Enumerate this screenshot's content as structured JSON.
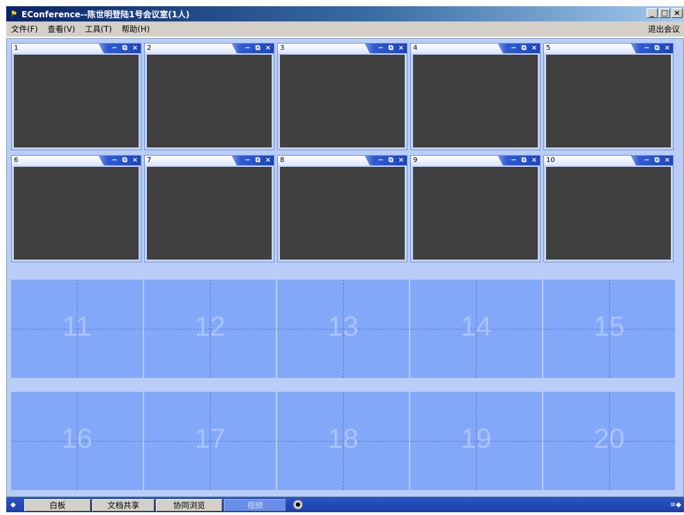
{
  "window": {
    "title": "EConference--陈世明登陆1号会议室(1人)",
    "icon": "app-logo-icon",
    "controls": [
      "_",
      "□",
      "×"
    ]
  },
  "menu": {
    "items": [
      "文件(F)",
      "查看(V)",
      "工具(T)",
      "帮助(H)"
    ],
    "exit": "退出会议"
  },
  "video_windows": [
    {
      "num": "1"
    },
    {
      "num": "2"
    },
    {
      "num": "3"
    },
    {
      "num": "4"
    },
    {
      "num": "5"
    },
    {
      "num": "6"
    },
    {
      "num": "7"
    },
    {
      "num": "8"
    },
    {
      "num": "9"
    },
    {
      "num": "10"
    }
  ],
  "window_controls": {
    "minimize": "−",
    "restore": "⧉",
    "close": "×"
  },
  "empty_slots": [
    "11",
    "12",
    "13",
    "14",
    "15",
    "16",
    "17",
    "18",
    "19",
    "20"
  ],
  "tabs": [
    "白板",
    "文档共享",
    "协同浏览",
    "视频"
  ],
  "active_tab": "视频",
  "colors": {
    "title_bar": "#0a246a",
    "panel_bg": "#b9cdf8",
    "video_screen": "#404040",
    "empty_slot": "#84a8f9",
    "tab_bar": "#1b3fa8"
  }
}
